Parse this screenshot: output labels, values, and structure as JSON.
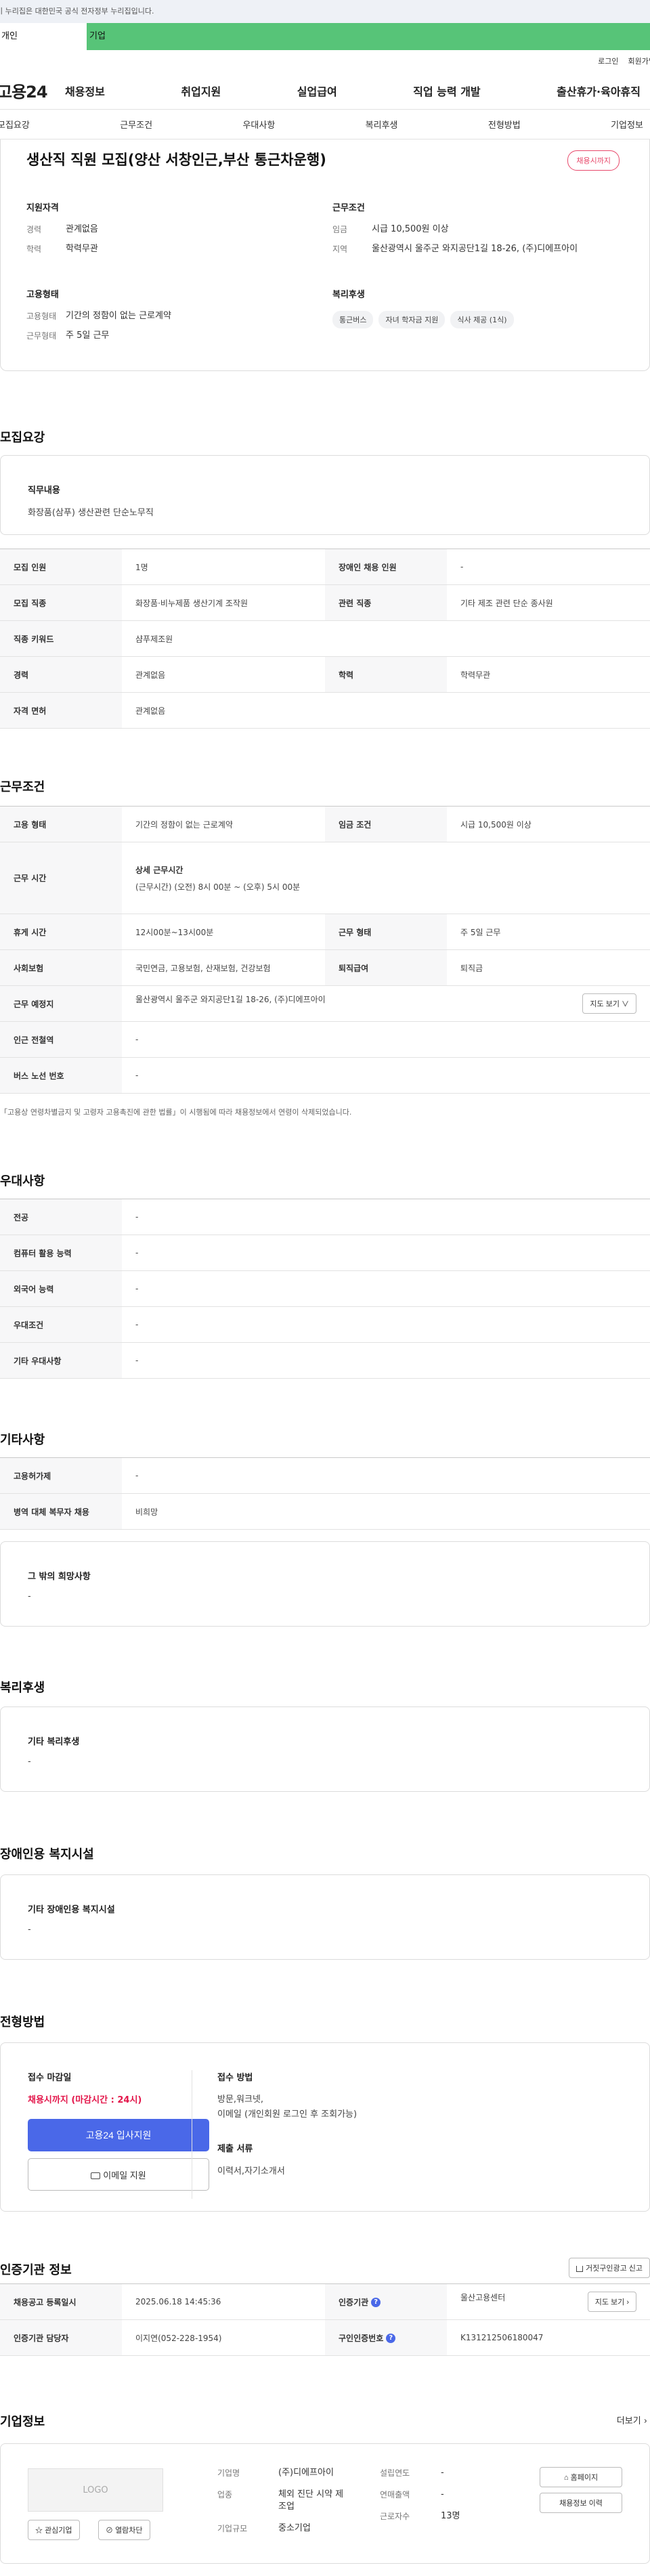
{
  "gov_banner": "이 누리집은 대한민국 공식 전자정부 누리집입니다.",
  "user_tabs": [
    "개인",
    "기업"
  ],
  "top_links": [
    "로그인",
    "회원가입"
  ],
  "logo": "고용24",
  "gnb": [
    "채용정보",
    "취업지원",
    "실업급여",
    "직업 능력 개발",
    "출산휴가·육아휴직"
  ],
  "subnav": [
    "모집요강",
    "근무조건",
    "우대사항",
    "복리후생",
    "전형방법",
    "기업정보"
  ],
  "job": {
    "title": "생산직 직원 모집(양산 서창인근,부산 통근차운행)",
    "badge": "채용시까지",
    "qual_head": "지원자격",
    "qual": [
      {
        "k": "경력",
        "v": "관계없음"
      },
      {
        "k": "학력",
        "v": "학력무관"
      }
    ],
    "cond_head": "근무조건",
    "cond": [
      {
        "k": "임금",
        "v": "시급 10,500원 이상"
      },
      {
        "k": "지역",
        "v": "울산광역시 울주군 와지공단1길 18-26, (주)디에프아이"
      }
    ],
    "emp_head": "고용형태",
    "emp": [
      {
        "k": "고용형태",
        "v": "기간의 정함이 없는 근로계약"
      },
      {
        "k": "근무형태",
        "v": "주 5일 근무"
      }
    ],
    "welfare_head": "복리후생",
    "welfare_chips": [
      "통근버스",
      "자녀 학자금 지원",
      "식사 제공 (1식)"
    ]
  },
  "recruit": {
    "title": "모집요강",
    "duty_head": "직무내용",
    "duty": "화장품(삼푸) 생산관련 단순노무직",
    "rows": [
      [
        "모집 인원",
        "1명",
        "장애인 채용 인원",
        "-"
      ],
      [
        "모집 직종",
        "화장품·비누제품 생산기계 조작원",
        "관련 직종",
        "기타 제조 관련 단순 종사원"
      ],
      [
        "직종 키워드",
        "샴푸제조원"
      ],
      [
        "경력",
        "관계없음",
        "학력",
        "학력무관"
      ],
      [
        "자격 면허",
        "관계없음"
      ]
    ]
  },
  "work": {
    "title": "근무조건",
    "r1": [
      "고용 형태",
      "기간의 정함이 없는 근로계약",
      "임금 조건",
      "시급 10,500원 이상"
    ],
    "r2_k": "근무 시간",
    "r2_head": "상세 근무시간",
    "r2_v": "(근무시간) (오전) 8시 00분 ~ (오후) 5시 00분",
    "r3": [
      "휴게 시간",
      "12시00분~13시00분",
      "근무 형태",
      "주 5일 근무"
    ],
    "r4": [
      "사회보험",
      "국민연금, 고용보험, 산재보험, 건강보험",
      "퇴직급여",
      "퇴직금"
    ],
    "r5_k": "근무 예정지",
    "r5_v": "울산광역시 울주군 와지공단1길 18-26, (주)디에프아이",
    "map_btn": "지도 보기 ∨",
    "r6": [
      "인근 전철역",
      "-"
    ],
    "r7": [
      "버스 노선 번호",
      "-"
    ],
    "note": "「고용상 연령차별금지 및 고령자 고용촉진에 관한 법률」이 시행됨에 따라 채용정보에서 연령이 삭제되었습니다."
  },
  "pref": {
    "title": "우대사항",
    "rows": [
      [
        "전공",
        "-"
      ],
      [
        "컴퓨터 활용 능력",
        "-"
      ],
      [
        "외국어 능력",
        "-"
      ],
      [
        "우대조건",
        "-"
      ],
      [
        "기타 우대사항",
        "-"
      ]
    ]
  },
  "etc": {
    "title": "기타사항",
    "rows": [
      [
        "고용허가제",
        "-"
      ],
      [
        "병역 대체 복무자 채용",
        "비희망"
      ]
    ],
    "box_head": "그 밖의 희망사항",
    "box_val": "-"
  },
  "welfare": {
    "title": "복리후생",
    "box_head": "기타 복리후생",
    "box_val": "-"
  },
  "disabled": {
    "title": "장애인용 복지시설",
    "box_head": "기타 장애인용 복지시설",
    "box_val": "-"
  },
  "process": {
    "title": "전형방법",
    "deadline_head": "접수 마감일",
    "deadline_val": "채용시까지 (마감시간 : 24시)",
    "apply_btn": "고용24 입사지원",
    "email_btn": "이메일 지원",
    "method_head": "접수 방법",
    "method_val1": "방문,워크넷,",
    "method_val2": "이메일 (개인회원 로그인 후 조회가능)",
    "docs_head": "제출 서류",
    "docs_val": "이력서,자기소개서"
  },
  "agency": {
    "title": "인증기관 정보",
    "report_btn": "거짓구인광고 신고",
    "r1": [
      "채용공고 등록일시",
      "2025.06.18 14:45:36",
      "인증기관",
      "울산고용센터"
    ],
    "r2": [
      "인증기관 담당자",
      "이지연(052-228-1954)",
      "구인인증번호",
      "K131212506180047"
    ],
    "map_btn": "지도 보기 ›"
  },
  "company": {
    "title": "기업정보",
    "more": "더보기 ›",
    "logo_text": "LOGO",
    "fav_btn": "관심기업",
    "block_btn": "열람차단",
    "rows_a": [
      [
        "기업명",
        "(주)디에프아이"
      ],
      [
        "업종",
        "체외 진단 시약 제조업"
      ],
      [
        "기업규모",
        "중소기업"
      ]
    ],
    "rows_b": [
      [
        "설립연도",
        "-"
      ],
      [
        "연매출액",
        "-"
      ],
      [
        "근로자수",
        "13명"
      ]
    ],
    "home_btn": "홈페이지",
    "history_btn": "채용정보 이력"
  }
}
